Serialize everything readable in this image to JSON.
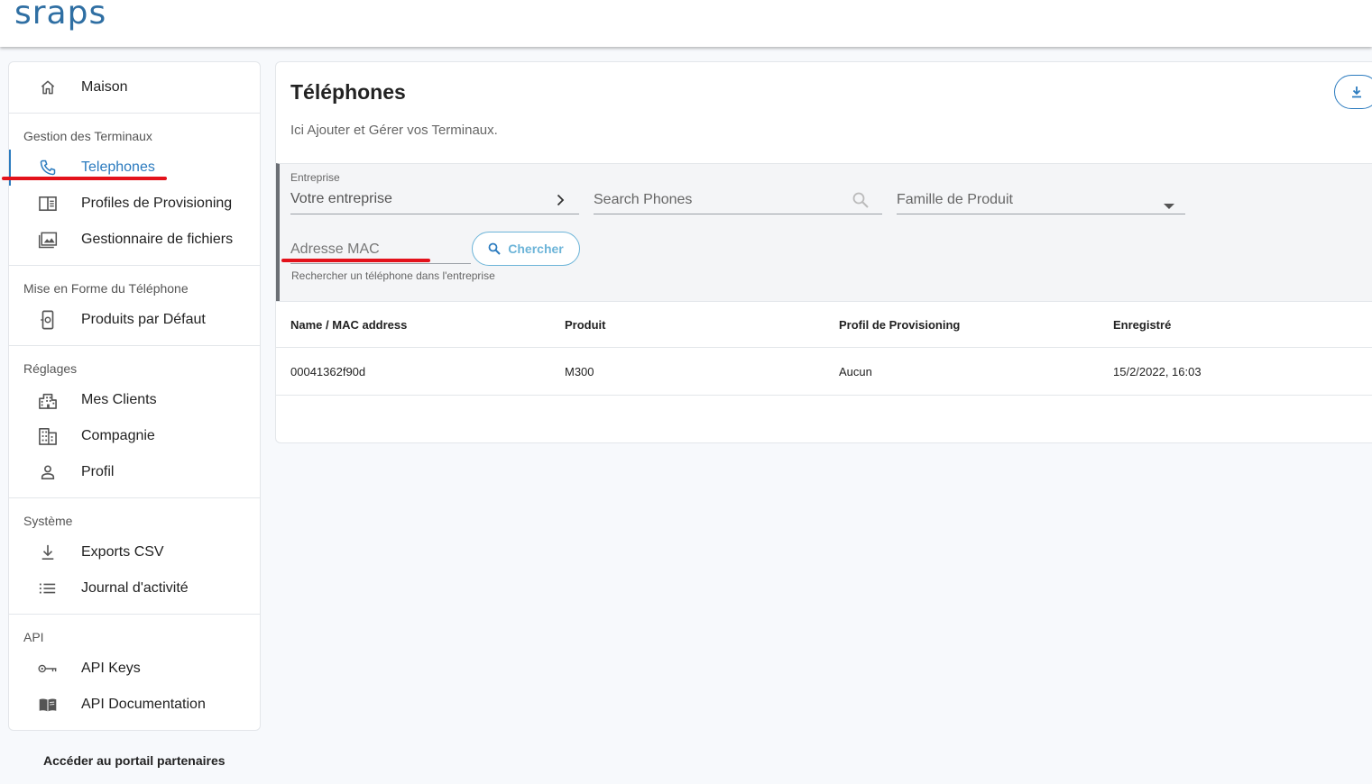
{
  "app": {
    "logo_text": "sraps",
    "brand_color": "#2f6fa3",
    "accent_color": "#2b7bbf",
    "annotation_color": "#e3121b"
  },
  "sidebar": {
    "home": {
      "label": "Maison",
      "icon": "home-icon"
    },
    "sections": [
      {
        "title": "Gestion des Terminaux",
        "items": [
          {
            "label": "Telephones",
            "icon": "phone-icon",
            "active": true
          },
          {
            "label": "Profiles de Provisioning",
            "icon": "provisioning-icon"
          },
          {
            "label": "Gestionnaire de fichiers",
            "icon": "file-manager-icon"
          }
        ]
      },
      {
        "title": "Mise en Forme du Téléphone",
        "items": [
          {
            "label": "Produits par Défaut",
            "icon": "device-settings-icon"
          }
        ]
      },
      {
        "title": "Réglages",
        "items": [
          {
            "label": "Mes Clients",
            "icon": "clients-icon"
          },
          {
            "label": "Compagnie",
            "icon": "company-icon"
          },
          {
            "label": "Profil",
            "icon": "person-icon"
          }
        ]
      },
      {
        "title": "Système",
        "items": [
          {
            "label": "Exports CSV",
            "icon": "download-icon"
          },
          {
            "label": "Journal d'activité",
            "icon": "list-icon"
          }
        ]
      },
      {
        "title": "API",
        "items": [
          {
            "label": "API Keys",
            "icon": "key-icon"
          },
          {
            "label": "API Documentation",
            "icon": "book-icon"
          }
        ]
      }
    ],
    "partner_link": "Accéder au portail partenaires"
  },
  "main": {
    "title": "Téléphones",
    "subtitle": "Ici Ajouter et Gérer vos Terminaux.",
    "export_icon": "download-icon",
    "filters": {
      "enterprise_label": "Entreprise",
      "enterprise_value": "Votre entreprise",
      "search_placeholder": "Search Phones",
      "product_family_placeholder": "Famille de Produit",
      "mac_placeholder": "Adresse MAC",
      "search_button": "Chercher",
      "hint": "Rechercher un téléphone dans l'entreprise"
    },
    "table": {
      "columns": [
        "Name / MAC address",
        "Produit",
        "Profil de Provisioning",
        "Enregistré"
      ],
      "rows": [
        [
          "00041362f90d",
          "M300",
          "Aucun",
          "15/2/2022, 16:03"
        ]
      ]
    }
  }
}
